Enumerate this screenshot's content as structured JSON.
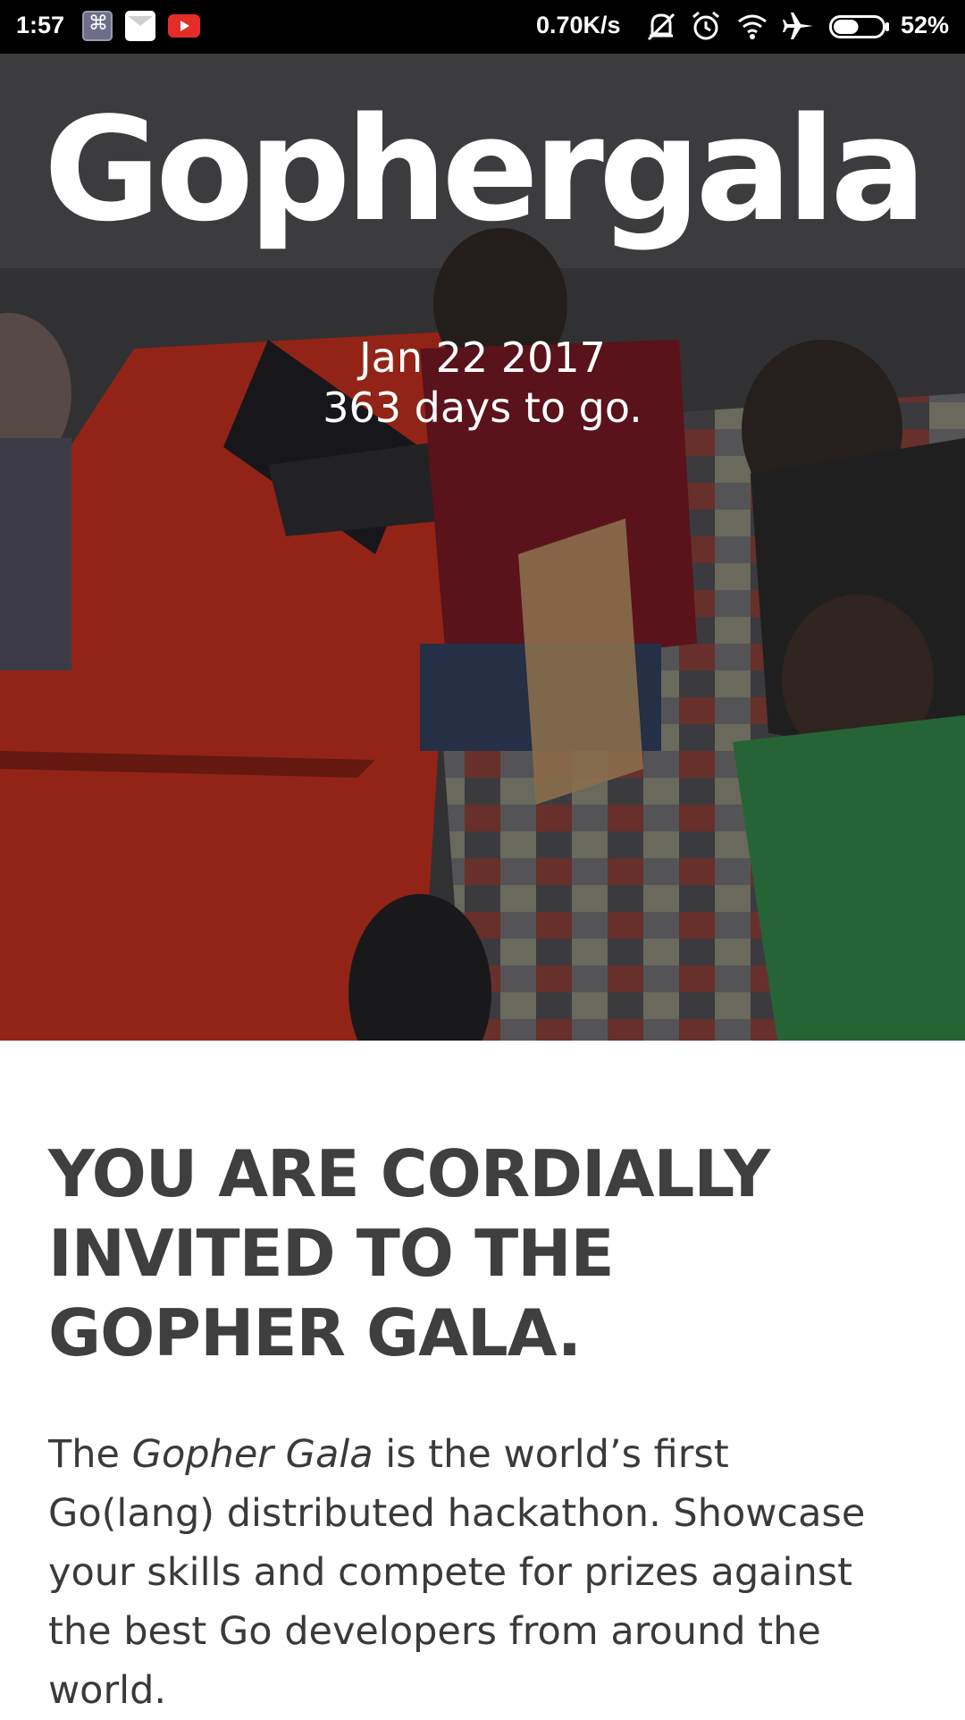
{
  "status_bar": {
    "time": "1:57",
    "network_speed": "0.70K/s",
    "battery_percent": "52%",
    "battery_level": 0.52,
    "icons": [
      "misc-app-icon",
      "mail-icon",
      "youtube-icon",
      "mute-bell-icon",
      "alarm-icon",
      "wifi-icon",
      "airplane-icon",
      "battery-icon"
    ]
  },
  "hero": {
    "title": "Gophergala",
    "date": "Jan 22 2017",
    "countdown": "363 days to go."
  },
  "invite": {
    "heading": "YOU ARE CORDIALLY INVITED TO THE GOPHER GALA.",
    "intro_prefix": "The ",
    "intro_emphasis": "Gopher Gala",
    "intro_rest": " is the world’s first Go(lang) distributed hackathon. Showcase your skills and compete for prizes against the best Go developers from around the world."
  },
  "colors": {
    "status_bar_bg": "#000000",
    "heading": "#3f3f3f",
    "body_text": "#3a3a3a",
    "table_red": "#c0321f"
  }
}
